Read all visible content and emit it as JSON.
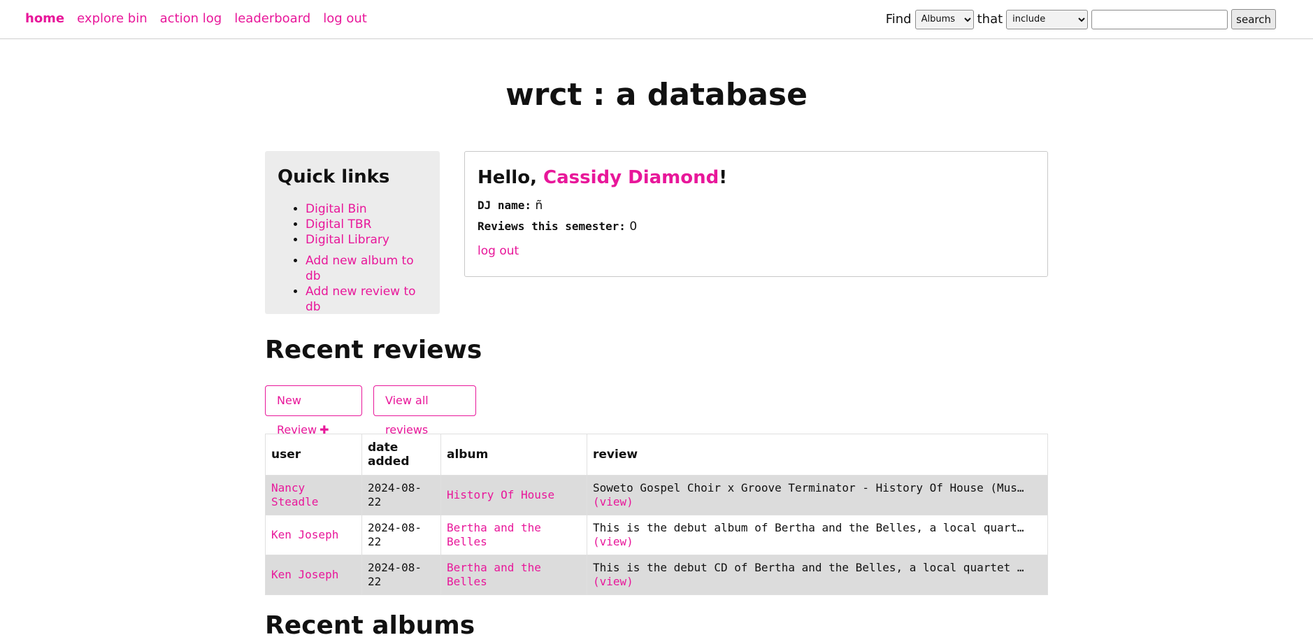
{
  "nav": {
    "items": [
      "home",
      "explore bin",
      "action log",
      "leaderboard",
      "log out"
    ]
  },
  "search": {
    "find_label": "Find",
    "type_selected": "Albums",
    "that_label": "that",
    "op_selected": "include",
    "query_value": "",
    "button_label": "search"
  },
  "site_title": "wrct : a database",
  "quick_links": {
    "title": "Quick links",
    "group1": [
      "Digital Bin",
      "Digital TBR",
      "Digital Library"
    ],
    "group2": [
      "Add new album to db",
      "Add new review to db"
    ]
  },
  "hello": {
    "prefix": "Hello, ",
    "user": "Cassidy Diamond",
    "suffix": "!",
    "dj_label": "DJ name:",
    "dj_value": "ñ",
    "reviews_label": "Reviews this semester:",
    "reviews_value": "0",
    "logout_label": "log out"
  },
  "recent_reviews": {
    "title": "Recent reviews",
    "new_button": "New Review",
    "new_icon": "plus-icon",
    "all_button": "View all reviews",
    "columns": [
      "user",
      "date added",
      "album",
      "review"
    ],
    "rows": [
      {
        "user": "Nancy Steadle",
        "date": "2024-08-22",
        "album": "History Of House",
        "review": "Soweto Gospel Choir x Groove Terminator - History Of House (Mus…",
        "view": "(view)"
      },
      {
        "user": "Ken Joseph",
        "date": "2024-08-22",
        "album": "Bertha and the Belles",
        "review": "This is the debut album of Bertha and the Belles, a local quart…",
        "view": "(view)"
      },
      {
        "user": "Ken Joseph",
        "date": "2024-08-22",
        "album": "Bertha and the Belles",
        "review": "This is the debut CD of Bertha and the Belles, a local quartet …",
        "view": "(view)"
      }
    ]
  },
  "next_section_title": "Recent albums",
  "colors": {
    "accent": "#e8179a",
    "panel": "#ececec",
    "row_shade": "#dcdcdc"
  }
}
